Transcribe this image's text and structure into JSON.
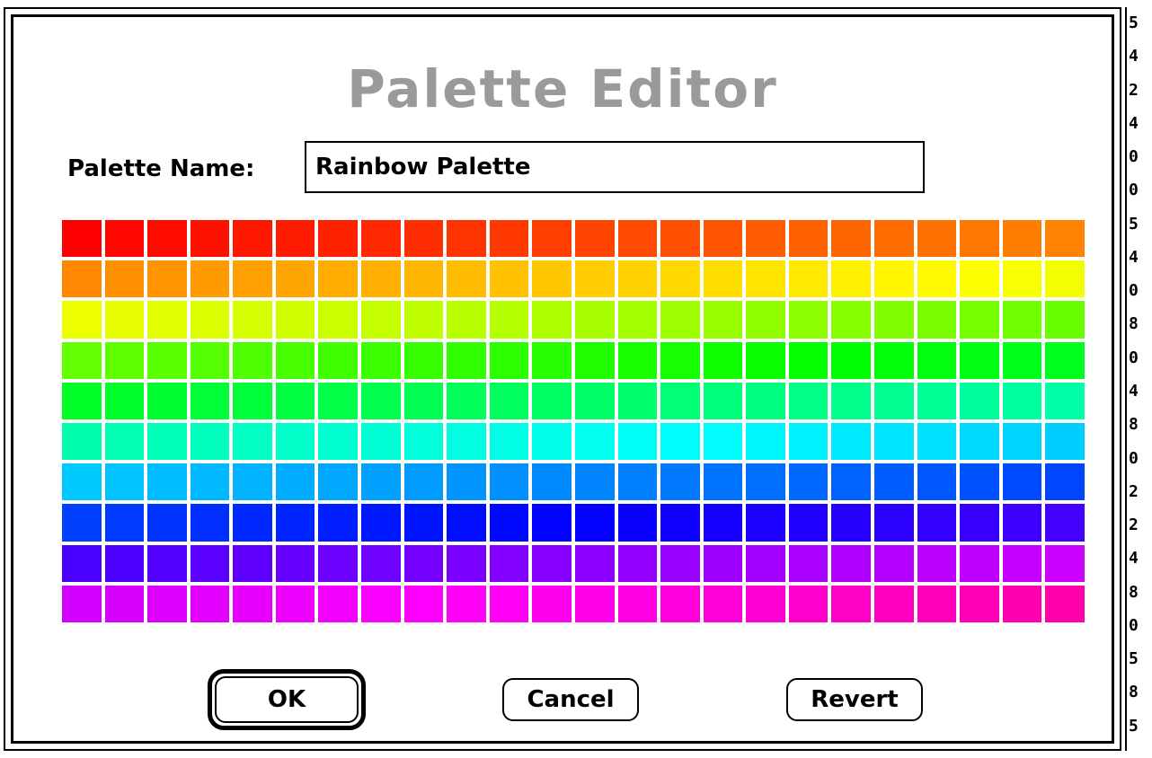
{
  "dialog": {
    "title": "Palette Editor",
    "name_label": "Palette Name:",
    "name_value": "Rainbow Palette",
    "buttons": {
      "ok": "OK",
      "cancel": "Cancel",
      "revert": "Revert"
    }
  },
  "palette": {
    "rows": 10,
    "columns": 24,
    "hue_start_deg": 0,
    "hue_end_deg": 320,
    "saturation_pct": 100,
    "lightness_pct": 50
  },
  "background_strip": {
    "digits": [
      "5",
      "4",
      "2",
      "4",
      "0",
      "0",
      "5",
      "4",
      "0",
      "8",
      "0",
      "4",
      "8",
      "0",
      "2",
      "2",
      "4",
      "8",
      "0",
      "5",
      "8",
      "5"
    ]
  }
}
